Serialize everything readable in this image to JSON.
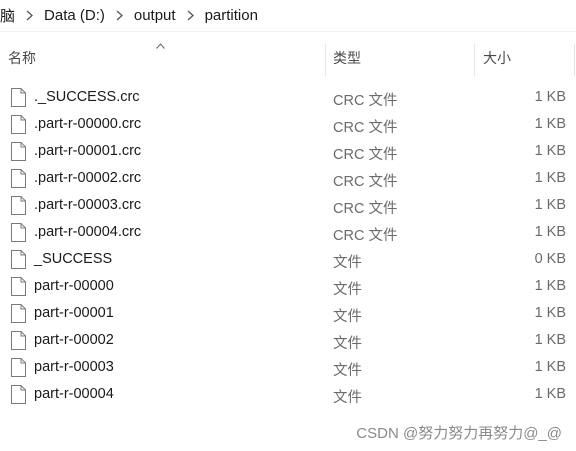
{
  "breadcrumb": [
    "脑",
    "Data (D:)",
    "output",
    "partition"
  ],
  "columns": {
    "name": "名称",
    "type": "类型",
    "size": "大小"
  },
  "files": [
    {
      "name": "._SUCCESS.crc",
      "type": "CRC 文件",
      "size": "1 KB"
    },
    {
      "name": ".part-r-00000.crc",
      "type": "CRC 文件",
      "size": "1 KB"
    },
    {
      "name": ".part-r-00001.crc",
      "type": "CRC 文件",
      "size": "1 KB"
    },
    {
      "name": ".part-r-00002.crc",
      "type": "CRC 文件",
      "size": "1 KB"
    },
    {
      "name": ".part-r-00003.crc",
      "type": "CRC 文件",
      "size": "1 KB"
    },
    {
      "name": ".part-r-00004.crc",
      "type": "CRC 文件",
      "size": "1 KB"
    },
    {
      "name": "_SUCCESS",
      "type": "文件",
      "size": "0 KB"
    },
    {
      "name": "part-r-00000",
      "type": "文件",
      "size": "1 KB"
    },
    {
      "name": "part-r-00001",
      "type": "文件",
      "size": "1 KB"
    },
    {
      "name": "part-r-00002",
      "type": "文件",
      "size": "1 KB"
    },
    {
      "name": "part-r-00003",
      "type": "文件",
      "size": "1 KB"
    },
    {
      "name": "part-r-00004",
      "type": "文件",
      "size": "1 KB"
    }
  ],
  "watermark": "CSDN @努力努力再努力@_@",
  "icons": {
    "file": "file-icon",
    "separator": "chevron-right-icon",
    "sort": "sort-up-icon"
  }
}
